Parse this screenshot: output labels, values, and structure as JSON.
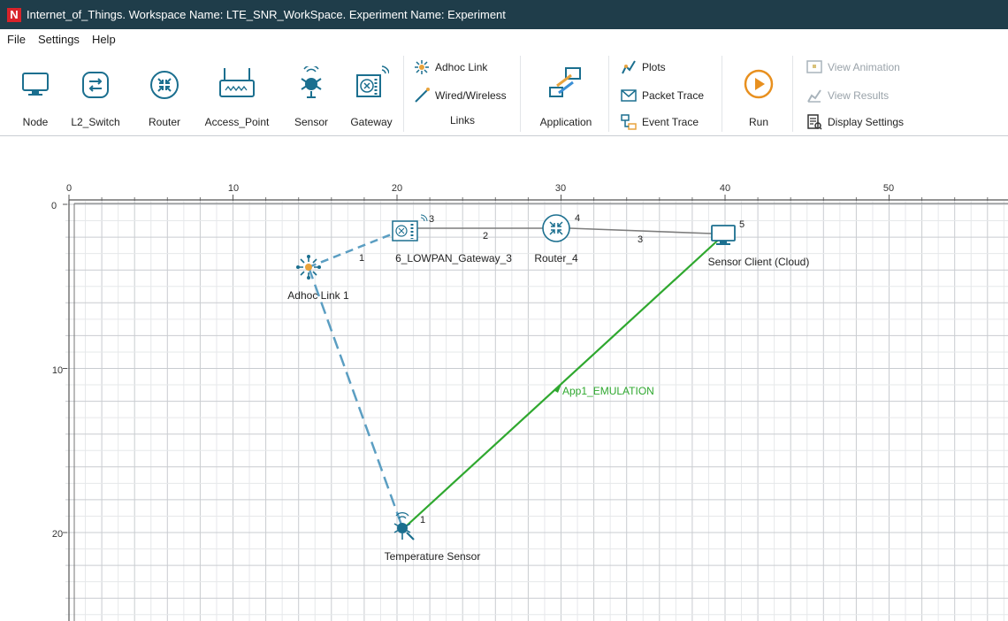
{
  "window": {
    "title": "Internet_of_Things. Workspace Name: LTE_SNR_WorkSpace. Experiment Name: Experiment",
    "logo_letter": "N"
  },
  "menu": [
    "File",
    "Settings",
    "Help"
  ],
  "ribbon": {
    "node": "Node",
    "l2_switch": "L2_Switch",
    "router": "Router",
    "access_point": "Access_Point",
    "sensor": "Sensor",
    "gateway": "Gateway",
    "adhoc_link": "Adhoc Link",
    "wired_wireless": "Wired/Wireless",
    "links": "Links",
    "application": "Application",
    "plots": "Plots",
    "packet_trace": "Packet Trace",
    "event_trace": "Event Trace",
    "run": "Run",
    "view_animation": "View Animation",
    "view_results": "View Results",
    "display_settings": "Display Settings"
  },
  "axes": {
    "x_ticks": [
      "0",
      "10",
      "20",
      "30",
      "40",
      "50"
    ],
    "y_ticks": [
      "0",
      "10",
      "20"
    ]
  },
  "nodes": {
    "gateway": {
      "label": "6_LOWPAN_Gateway_3",
      "id": "3"
    },
    "router": {
      "label": "Router_4",
      "id": "4"
    },
    "client": {
      "label": "Sensor Client (Cloud)",
      "id": "5"
    },
    "adhoc": {
      "label": "Adhoc Link 1"
    },
    "sensor": {
      "label": "Temperature Sensor",
      "id": "1"
    }
  },
  "links": {
    "l1": "1",
    "l2": "2",
    "l3": "3"
  },
  "application": {
    "label": "App1_EMULATION",
    "color": "#2fa82f"
  },
  "colors": {
    "titlebar": "#1f3d4a",
    "adhoc_link": "#5b9ec2",
    "wired_link": "#7d7d7d",
    "icon": "#1b6f8f"
  }
}
